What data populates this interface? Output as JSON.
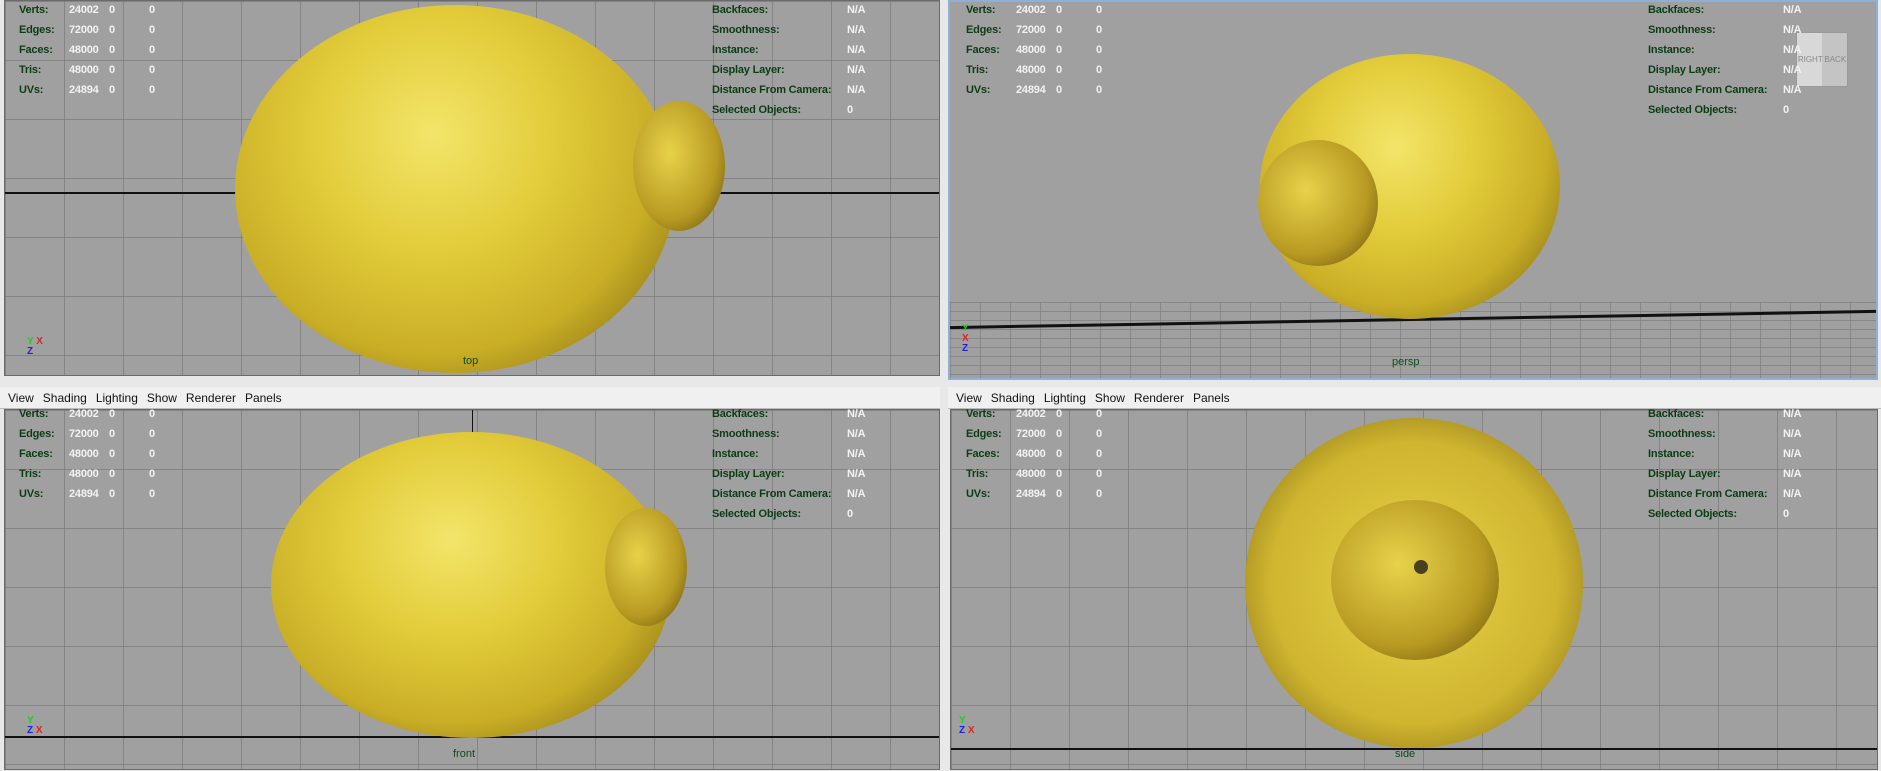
{
  "menu": [
    "View",
    "Shading",
    "Lighting",
    "Show",
    "Renderer",
    "Panels"
  ],
  "stats_left": [
    {
      "label": "Verts:",
      "v": [
        "24002",
        "0",
        "0"
      ]
    },
    {
      "label": "Edges:",
      "v": [
        "72000",
        "0",
        "0"
      ]
    },
    {
      "label": "Faces:",
      "v": [
        "48000",
        "0",
        "0"
      ]
    },
    {
      "label": "Tris:",
      "v": [
        "48000",
        "0",
        "0"
      ]
    },
    {
      "label": "UVs:",
      "v": [
        "24894",
        "0",
        "0"
      ]
    }
  ],
  "stats_right": [
    {
      "label": "Backfaces:",
      "v": "N/A"
    },
    {
      "label": "Smoothness:",
      "v": "N/A"
    },
    {
      "label": "Instance:",
      "v": "N/A"
    },
    {
      "label": "Display Layer:",
      "v": "N/A"
    },
    {
      "label": "Distance From Camera:",
      "v": "N/A"
    },
    {
      "label": "Selected Objects:",
      "v": "0"
    }
  ],
  "panels": {
    "top": "top",
    "persp": "persp",
    "front": "front",
    "side": "side"
  },
  "viewcube": {
    "face1": "RIGHT",
    "face2": "BACK"
  },
  "axes": {
    "x": "X",
    "y": "Y",
    "z": "Z"
  },
  "colors": {
    "viewport": "#a0a0a0",
    "label_green": "#0b3d14",
    "lemon": "#e2cc3a"
  }
}
